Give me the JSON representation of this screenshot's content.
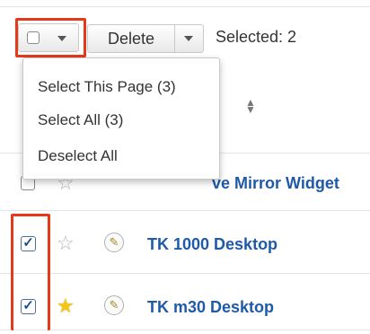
{
  "toolbar": {
    "delete_label": "Delete",
    "selected_text": "Selected: 2"
  },
  "mass_select_menu": {
    "items": [
      {
        "label": "Select This Page (3)"
      },
      {
        "label": "Select All (3)"
      },
      {
        "label": "Deselect All"
      }
    ]
  },
  "list": {
    "sort_icon": "sort-icon",
    "rows": [
      {
        "name": "ve Mirror Widget",
        "checked": false,
        "favorite": false
      },
      {
        "name": "TK 1000 Desktop",
        "checked": true,
        "favorite": false
      },
      {
        "name": "TK m30 Desktop",
        "checked": true,
        "favorite": true
      }
    ]
  },
  "colors": {
    "highlight": "#e5391a",
    "link": "#1f5aa8",
    "star_filled": "#f6c615"
  }
}
